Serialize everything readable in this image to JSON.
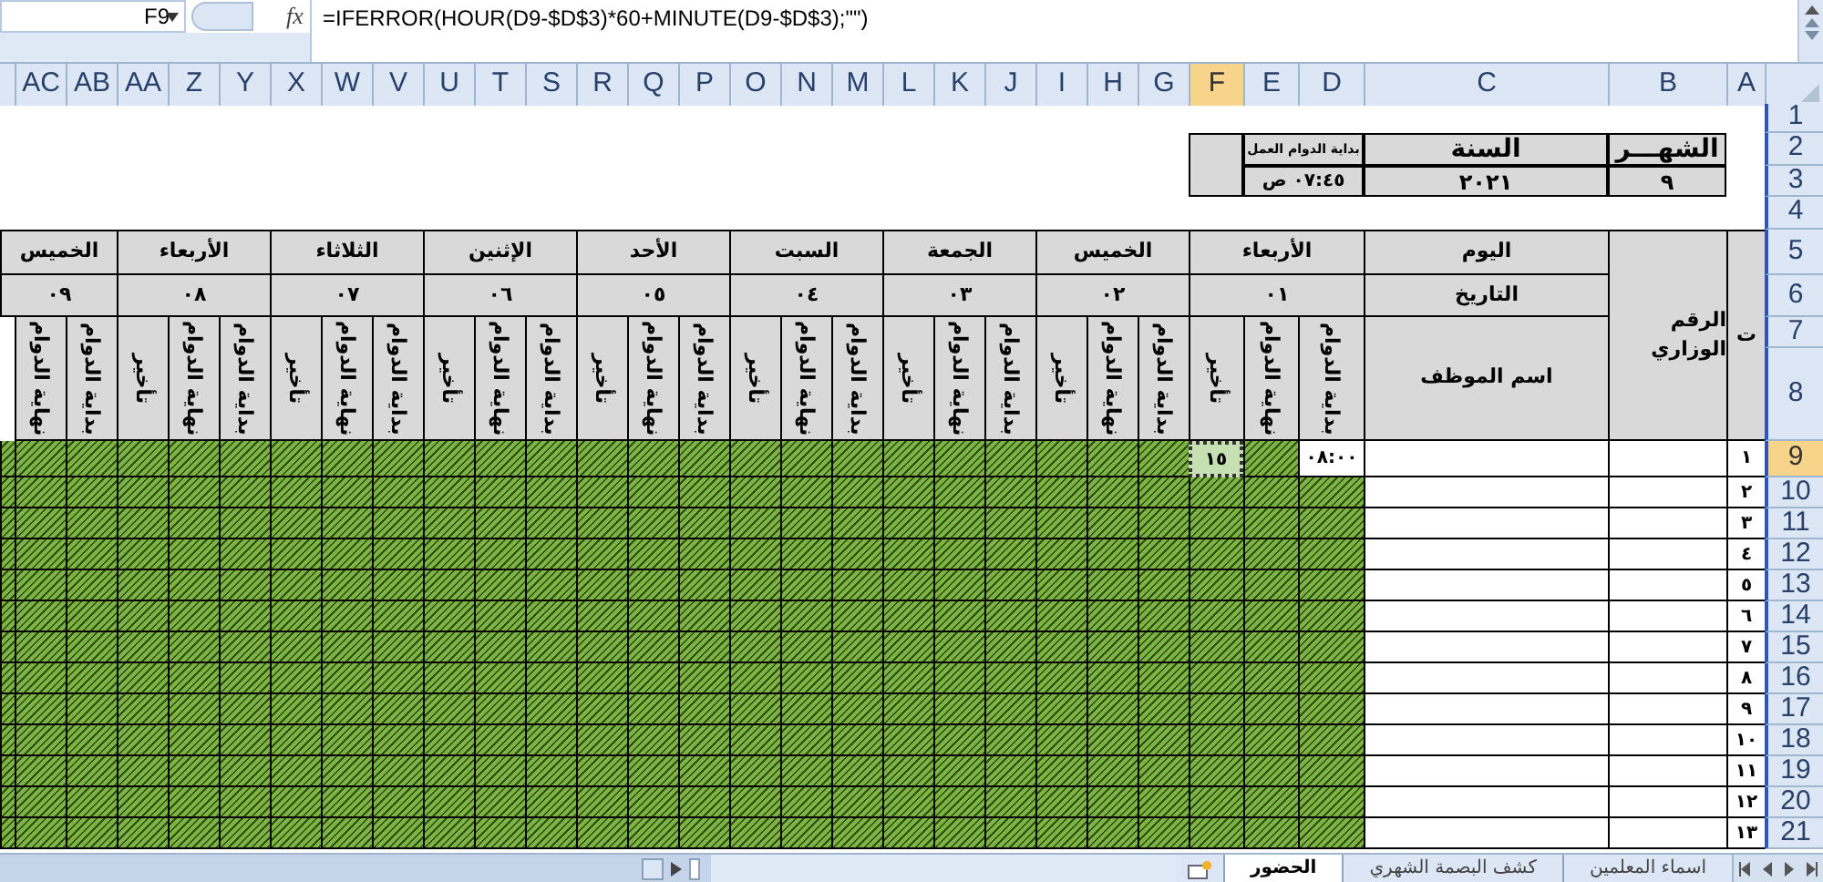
{
  "formula_bar": {
    "name_box": "F9",
    "fx_label": "fx",
    "formula": "=IFERROR(HOUR(D9-$D$3)*60+MINUTE(D9-$D$3);\"\")"
  },
  "columns": [
    {
      "label": "A",
      "selected": false
    },
    {
      "label": "B",
      "selected": false
    },
    {
      "label": "C",
      "selected": false
    },
    {
      "label": "D",
      "selected": false
    },
    {
      "label": "E",
      "selected": false
    },
    {
      "label": "F",
      "selected": true
    },
    {
      "label": "G",
      "selected": false
    },
    {
      "label": "H",
      "selected": false
    },
    {
      "label": "I",
      "selected": false
    },
    {
      "label": "J",
      "selected": false
    },
    {
      "label": "K",
      "selected": false
    },
    {
      "label": "L",
      "selected": false
    },
    {
      "label": "M",
      "selected": false
    },
    {
      "label": "N",
      "selected": false
    },
    {
      "label": "O",
      "selected": false
    },
    {
      "label": "P",
      "selected": false
    },
    {
      "label": "Q",
      "selected": false
    },
    {
      "label": "R",
      "selected": false
    },
    {
      "label": "S",
      "selected": false
    },
    {
      "label": "T",
      "selected": false
    },
    {
      "label": "U",
      "selected": false
    },
    {
      "label": "V",
      "selected": false
    },
    {
      "label": "W",
      "selected": false
    },
    {
      "label": "X",
      "selected": false
    },
    {
      "label": "Y",
      "selected": false
    },
    {
      "label": "Z",
      "selected": false
    },
    {
      "label": "AA",
      "selected": false
    },
    {
      "label": "AB",
      "selected": false
    },
    {
      "label": "AC",
      "selected": false
    }
  ],
  "row_headers": [
    {
      "label": "1",
      "selected": false
    },
    {
      "label": "2",
      "selected": false
    },
    {
      "label": "3",
      "selected": false
    },
    {
      "label": "4",
      "selected": false
    },
    {
      "label": "5",
      "selected": false
    },
    {
      "label": "6",
      "selected": false
    },
    {
      "label": "7",
      "selected": false
    },
    {
      "label": "8",
      "selected": false
    },
    {
      "label": "9",
      "selected": true
    },
    {
      "label": "10",
      "selected": false
    },
    {
      "label": "11",
      "selected": false
    },
    {
      "label": "12",
      "selected": false
    },
    {
      "label": "13",
      "selected": false
    },
    {
      "label": "14",
      "selected": false
    },
    {
      "label": "15",
      "selected": false
    },
    {
      "label": "16",
      "selected": false
    },
    {
      "label": "17",
      "selected": false
    },
    {
      "label": "18",
      "selected": false
    },
    {
      "label": "19",
      "selected": false
    },
    {
      "label": "20",
      "selected": false
    },
    {
      "label": "21",
      "selected": false
    }
  ],
  "info": {
    "month_label": "الشهـــر",
    "month": "٩",
    "year_label": "السنة",
    "year": "٢٠٢١",
    "start_label": "بداية الدوام العمل",
    "start_time": "٠٧:٤٥ ص"
  },
  "table": {
    "index_header": "ت",
    "id_header": "الرقم الوزاري",
    "day_label": "اليوم",
    "date_label": "التاريخ",
    "name_header": "اسم الموظف",
    "days": [
      {
        "name": "الأربعاء",
        "date": "٠١",
        "subheaders": [
          "بداية الدوام",
          "نهاية الدوام",
          "تأخير"
        ]
      },
      {
        "name": "الخميس",
        "date": "٠٢",
        "subheaders": [
          "بداية الدوام",
          "نهاية الدوام",
          "تأخير"
        ]
      },
      {
        "name": "الجمعة",
        "date": "٠٣",
        "subheaders": [
          "بداية الدوام",
          "نهاية الدوام",
          "تأخير"
        ]
      },
      {
        "name": "السبت",
        "date": "٠٤",
        "subheaders": [
          "بداية الدوام",
          "نهاية الدوام",
          "تأخير"
        ]
      },
      {
        "name": "الأحد",
        "date": "٠٥",
        "subheaders": [
          "بداية الدوام",
          "نهاية الدوام",
          "تأخير"
        ]
      },
      {
        "name": "الإثنين",
        "date": "٠٦",
        "subheaders": [
          "بداية الدوام",
          "نهاية الدوام",
          "تأخير"
        ]
      },
      {
        "name": "الثلاثاء",
        "date": "٠٧",
        "subheaders": [
          "بداية الدوام",
          "نهاية الدوام",
          "تأخير"
        ]
      },
      {
        "name": "الأربعاء",
        "date": "٠٨",
        "subheaders": [
          "بداية الدوام",
          "نهاية الدوام",
          "تأخير"
        ]
      },
      {
        "name": "الخميس",
        "date": "٠٩",
        "subheaders": [
          "بداية الدوام",
          "نهاية الدوام"
        ]
      }
    ],
    "rows": [
      {
        "index": "١",
        "entries": [
          {
            "start": "٠٨:٠٠",
            "delay": "١٥"
          }
        ]
      },
      {
        "index": "٢"
      },
      {
        "index": "٣"
      },
      {
        "index": "٤"
      },
      {
        "index": "٥"
      },
      {
        "index": "٦"
      },
      {
        "index": "٧"
      },
      {
        "index": "٨"
      },
      {
        "index": "٩"
      },
      {
        "index": "١٠"
      },
      {
        "index": "١١"
      },
      {
        "index": "١٢"
      },
      {
        "index": "١٣"
      }
    ]
  },
  "sheet_tabs": [
    {
      "label": "اسماء المعلمين",
      "selected": false
    },
    {
      "label": "كشف البصمة الشهري",
      "selected": false
    },
    {
      "label": "الحضور",
      "selected": true
    }
  ]
}
